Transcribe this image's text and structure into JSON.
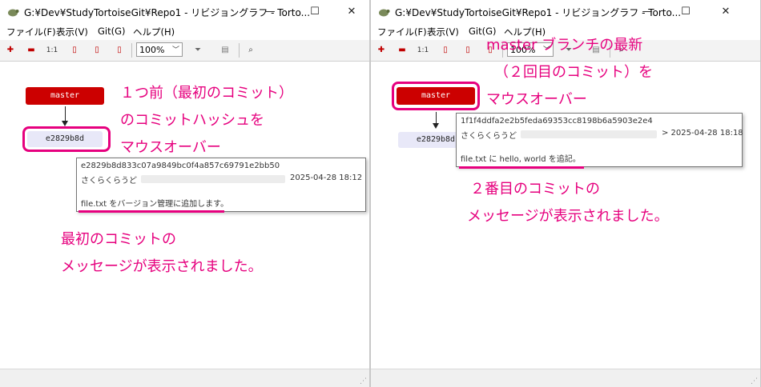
{
  "left": {
    "title": "G:¥Dev¥StudyTortoiseGit¥Repo1 - リビジョングラフ - Torto...",
    "menu": [
      "ファイル(F)",
      "表示(V)",
      "Git(G)",
      "ヘルプ(H)"
    ],
    "zoom": "100%",
    "branch": "master",
    "commit": "e2829b8d",
    "tooltip": {
      "hash": "e2829b8d833c07a9849bc0f4a857c69791e2bb50",
      "author": "さくらくらうど",
      "date": "2025-04-28 18:12",
      "message": "file.txt をバージョン管理に追加します。"
    },
    "annotation_top": [
      "１つ前（最初のコミット）",
      "のコミットハッシュを",
      "マウスオーバー"
    ],
    "annotation_bottom": [
      "最初のコミットの",
      "メッセージが表示されました。"
    ]
  },
  "right": {
    "title": "G:¥Dev¥StudyTortoiseGit¥Repo1 - リビジョングラフ - Torto...",
    "menu": [
      "ファイル(F)",
      "表示(V)",
      "Git(G)",
      "ヘルプ(H)"
    ],
    "zoom": "100%",
    "branch": "master",
    "commit": "e2829b8d",
    "tooltip": {
      "hash": "1f1f4ddfa2e2b5feda69353cc8198b6a5903e2e4",
      "author": "さくらくらうど",
      "date": "> 2025-04-28 18:18",
      "message": "file.txt に hello, world を追記。"
    },
    "annotation_top": [
      "master ブランチの最新",
      "（２回目のコミット）を",
      "マウスオーバー"
    ],
    "annotation_bottom": [
      "２番目のコミットの",
      "メッセージが表示されました。"
    ]
  },
  "window_controls": {
    "minimize": "—",
    "maximize": "☐",
    "close": "✕"
  },
  "colors": {
    "annotation": "#e6007e",
    "branch": "#cc0000",
    "commit": "#e8e8f8"
  }
}
